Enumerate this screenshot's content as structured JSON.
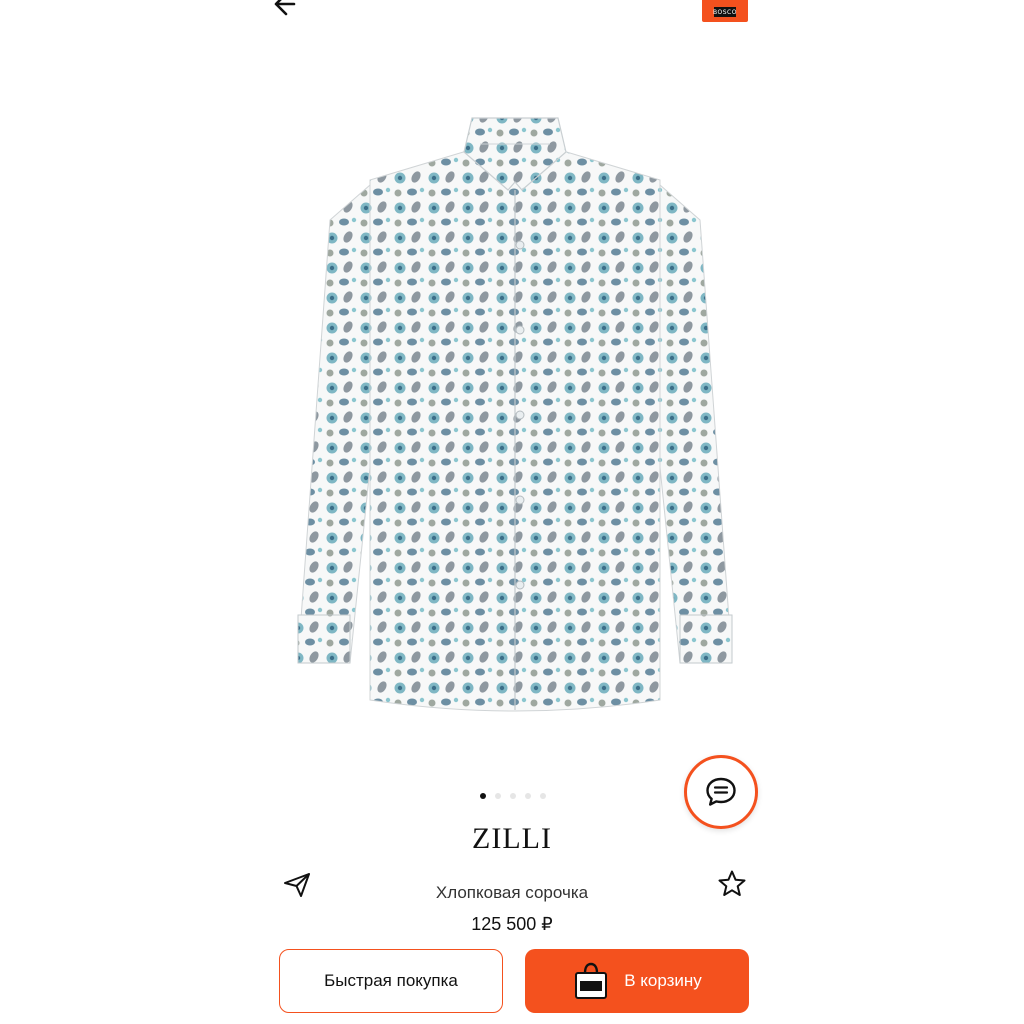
{
  "header": {
    "back_icon": "arrow-left-icon",
    "logo_icon": "store-logo",
    "logo_text": "BOSCO"
  },
  "product": {
    "image_icon": "shirt-image",
    "gallery": {
      "count": 5,
      "active_index": 0
    },
    "brand": "ZILLI",
    "name": "Хлопковая сорочка",
    "price": "125 500 ₽"
  },
  "actions": {
    "chat_icon": "chat-bubble-icon",
    "share_icon": "paper-plane-icon",
    "favorite_icon": "star-outline-icon",
    "quick_buy_label": "Быстрая покупка",
    "cart_label": "В корзину",
    "cart_icon": "shopping-bag-icon"
  },
  "colors": {
    "accent": "#f4511e",
    "text": "#111111",
    "background": "#ffffff"
  }
}
